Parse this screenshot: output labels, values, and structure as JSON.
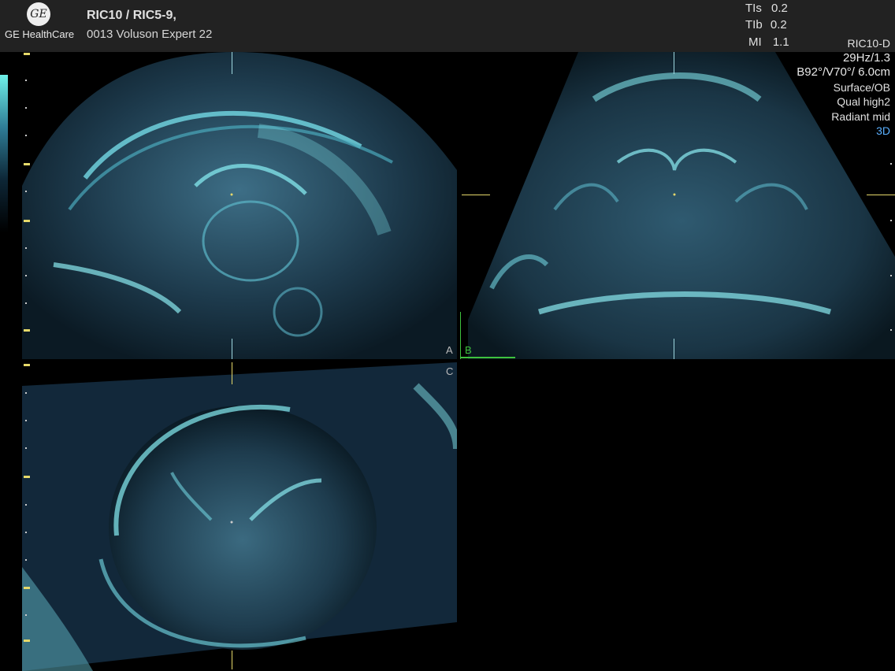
{
  "header": {
    "logo": "GE",
    "brand": "GE HealthCare",
    "probe": "RIC10 / RIC5-9,",
    "system": "0013 Voluson Expert 22"
  },
  "indices": [
    {
      "key": "TIs",
      "value": "0.2"
    },
    {
      "key": "TIb",
      "value": "0.2"
    },
    {
      "key": "MI",
      "value": "1.1"
    }
  ],
  "params": {
    "probe_mode": "RIC10-D",
    "frame_rate": "29Hz/1.3",
    "geometry": "B92°/V70°/ 6.0cm",
    "preset": "Surface/OB",
    "quality": "Qual high2",
    "render": "Radiant mid",
    "mode": "3D"
  },
  "planes": {
    "a": "A",
    "b": "B",
    "c": "C"
  },
  "colors": {
    "accent_blue": "#5ab0ff",
    "marker_yellow": "#e6d96a",
    "plane_b_green": "#3ec23e"
  }
}
